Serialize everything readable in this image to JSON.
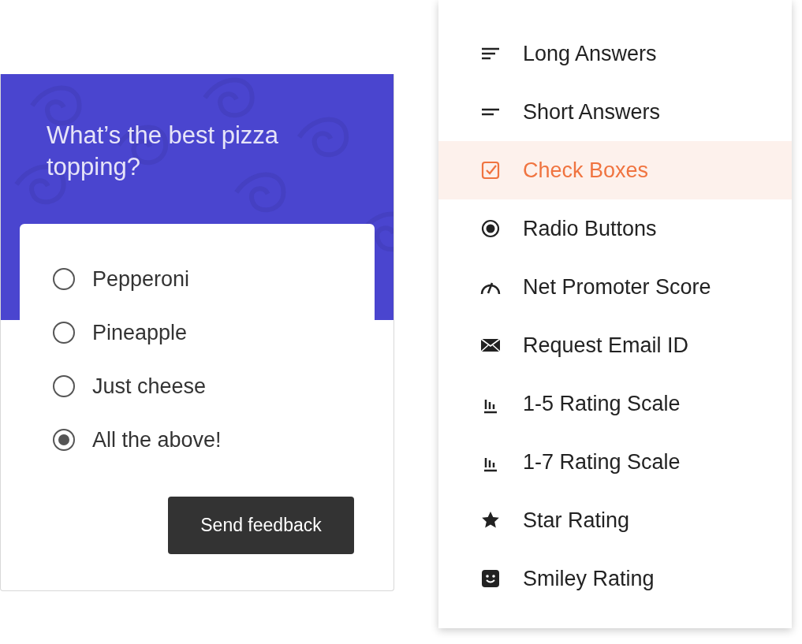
{
  "survey": {
    "question": "What’s the best pizza topping?",
    "options": [
      {
        "label": "Pepperoni",
        "selected": false
      },
      {
        "label": "Pineapple",
        "selected": false
      },
      {
        "label": "Just cheese",
        "selected": false
      },
      {
        "label": "All the above!",
        "selected": true
      }
    ],
    "submit": "Send feedback"
  },
  "question_types": [
    {
      "kind": "long",
      "label": "Long Answers",
      "selected": false
    },
    {
      "kind": "short",
      "label": "Short Answers",
      "selected": false
    },
    {
      "kind": "checkbox",
      "label": "Check Boxes",
      "selected": true
    },
    {
      "kind": "radio",
      "label": "Radio Buttons",
      "selected": false
    },
    {
      "kind": "nps",
      "label": "Net Promoter Score",
      "selected": false
    },
    {
      "kind": "email",
      "label": "Request Email ID",
      "selected": false
    },
    {
      "kind": "scale",
      "label": "1-5 Rating Scale",
      "selected": false
    },
    {
      "kind": "scale",
      "label": "1-7 Rating Scale",
      "selected": false
    },
    {
      "kind": "star",
      "label": "Star Rating",
      "selected": false
    },
    {
      "kind": "smiley",
      "label": "Smiley Rating",
      "selected": false
    }
  ]
}
